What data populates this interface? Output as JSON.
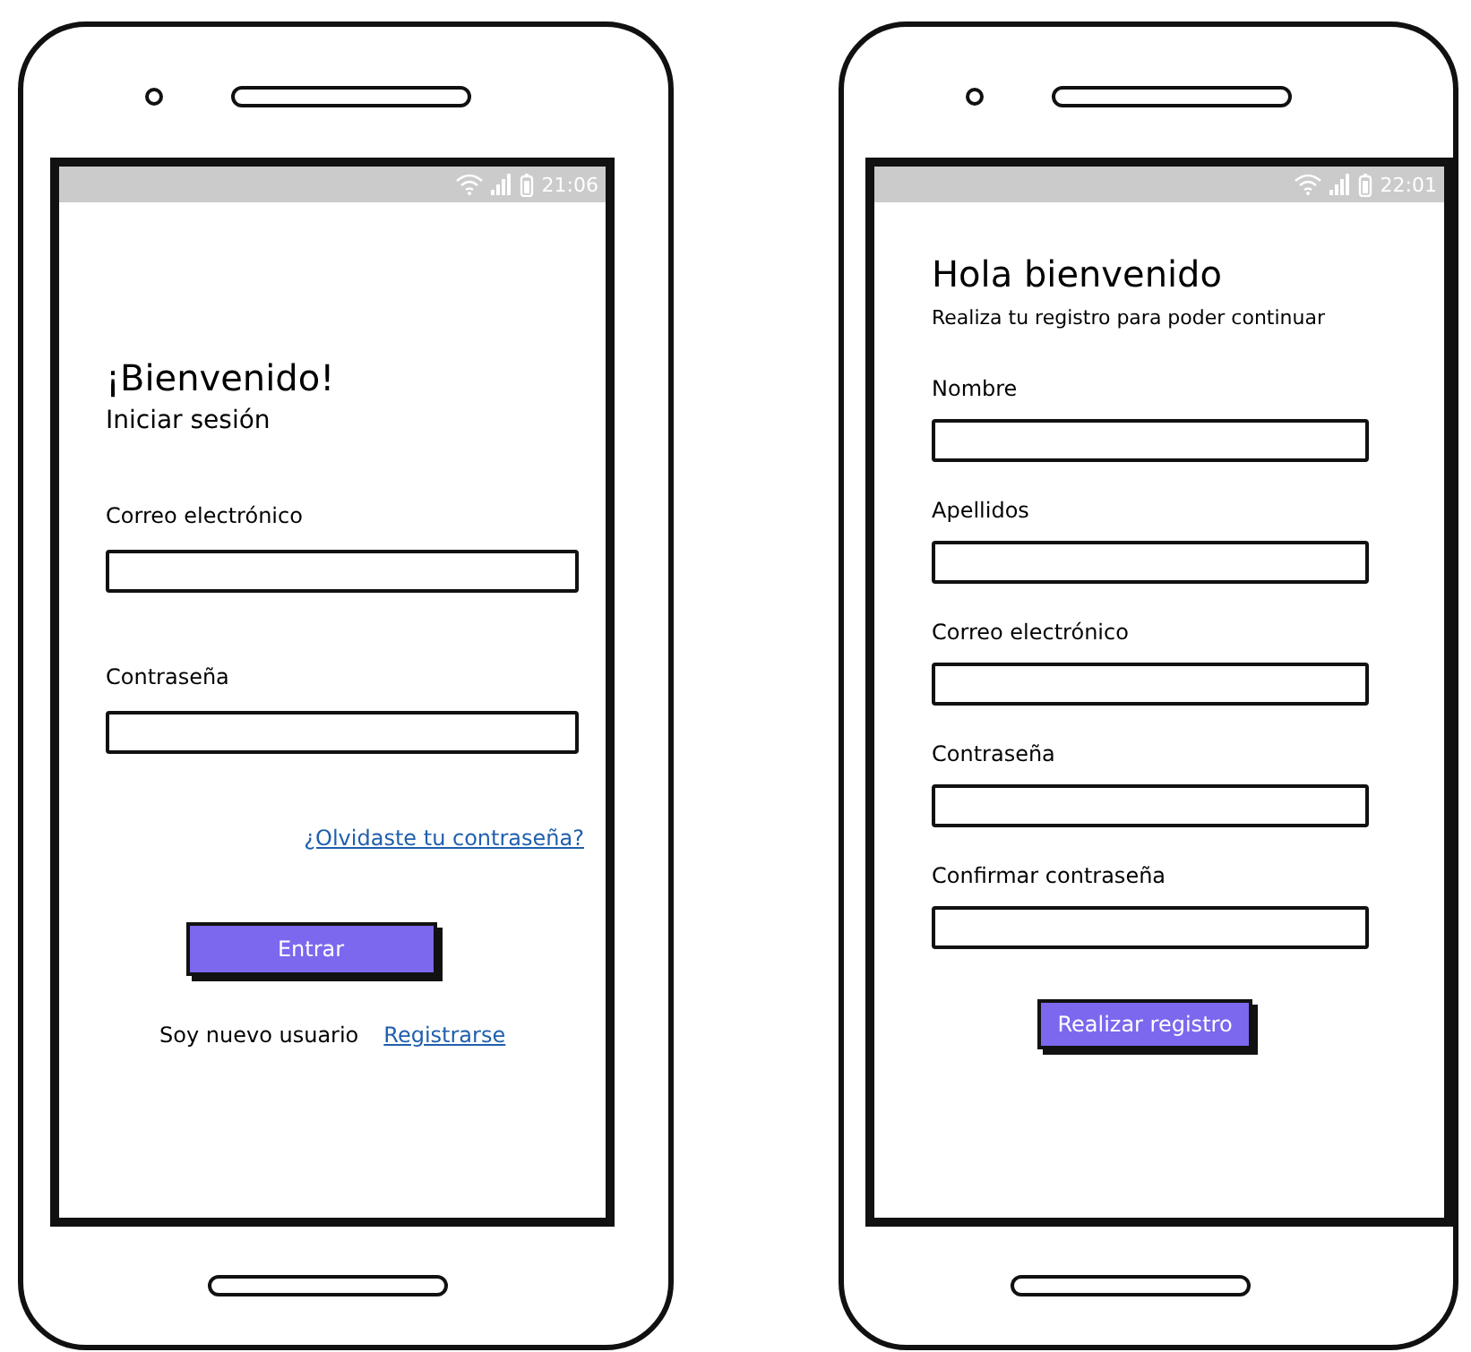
{
  "phones": [
    {
      "status_time": "21:06",
      "title": "¡Bienvenido!",
      "subtitle": "Iniciar sesión",
      "fields": [
        {
          "label": "Correo electrónico"
        },
        {
          "label": "Contraseña"
        }
      ],
      "forgot_link": "¿Olvidaste tu contraseña?",
      "button": "Entrar",
      "footer": {
        "text": "Soy nuevo usuario",
        "link": "Registrarse"
      }
    },
    {
      "status_time": "22:01",
      "title": "Hola bienvenido",
      "subtitle": "Realiza tu registro para poder continuar",
      "fields": [
        {
          "label": "Nombre"
        },
        {
          "label": "Apellidos"
        },
        {
          "label": "Correo electrónico"
        },
        {
          "label": "Contraseña"
        },
        {
          "label": "Confirmar contraseña"
        }
      ],
      "button": "Realizar registro"
    }
  ]
}
